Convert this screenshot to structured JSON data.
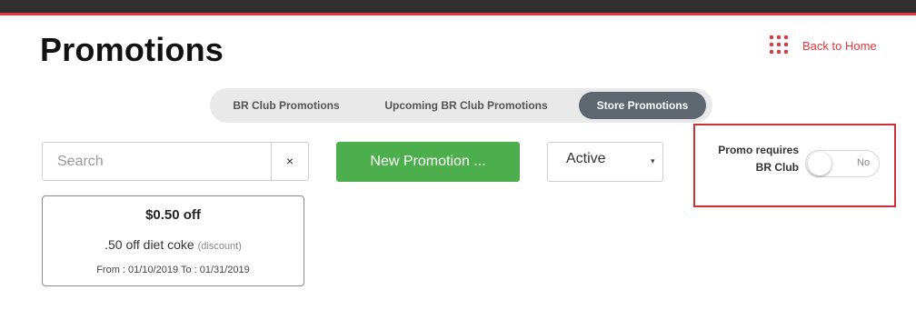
{
  "header": {
    "title": "Promotions",
    "back_link": "Back to Home",
    "back_icon": "grid-dots-icon",
    "accent_color": "#e8353b"
  },
  "tabs": [
    {
      "label": "BR Club Promotions",
      "active": false
    },
    {
      "label": "Upcoming BR Club Promotions",
      "active": false
    },
    {
      "label": "Store Promotions",
      "active": true
    }
  ],
  "toolbar": {
    "search_placeholder": "Search",
    "search_value": "",
    "clear_label": "×",
    "new_button_label": "New Promotion ...",
    "new_button_color": "#4cae4c",
    "status_selected": "Active",
    "status_caret": "▾"
  },
  "toggle": {
    "label_line1": "Promo requires",
    "label_line2": "BR Club",
    "state_text": "No",
    "on": false
  },
  "promotions": [
    {
      "amount": "$0.50 off",
      "description": ".50 off diet coke",
      "type_tag": "(discount)",
      "dates": "From : 01/10/2019 To : 01/31/2019"
    }
  ]
}
